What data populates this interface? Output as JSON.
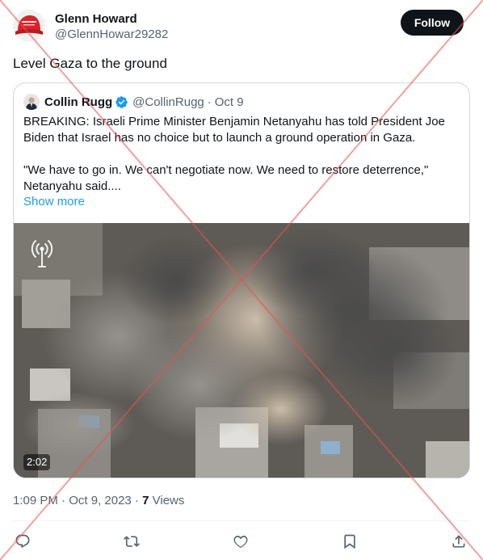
{
  "tweet": {
    "author_name": "Glenn Howard",
    "author_handle": "@GlennHowar29282",
    "follow_label": "Follow",
    "text": "Level Gaza to the ground",
    "time": "1:09 PM",
    "date": "Oct 9, 2023",
    "views_count": "7",
    "views_label": "Views",
    "icons": [
      "red-cap-avatar",
      "reply-icon",
      "retweet-icon",
      "like-icon",
      "bookmark-icon",
      "share-icon"
    ]
  },
  "quote": {
    "author_name": "Collin Rugg",
    "author_handle": "@CollinRugg",
    "separator": "·",
    "date": "Oct 9",
    "line1": "BREAKING: Israeli Prime Minister Benjamin Netanyahu has told President Joe Biden that Israel has no choice but to launch a ground operation in Gaza.",
    "line2": "\"We have to go in. We can't negotiate now. We need to restore deterrence,\" Netanyahu said....",
    "show_more": "Show more",
    "video_duration": "2:02",
    "verified_color": "#1d9bf0"
  },
  "colors": {
    "text": "#0f1419",
    "secondary": "#536471",
    "link": "#1d9bf0",
    "follow_bg": "#0f1419",
    "overlay_x": "#e8534f"
  }
}
